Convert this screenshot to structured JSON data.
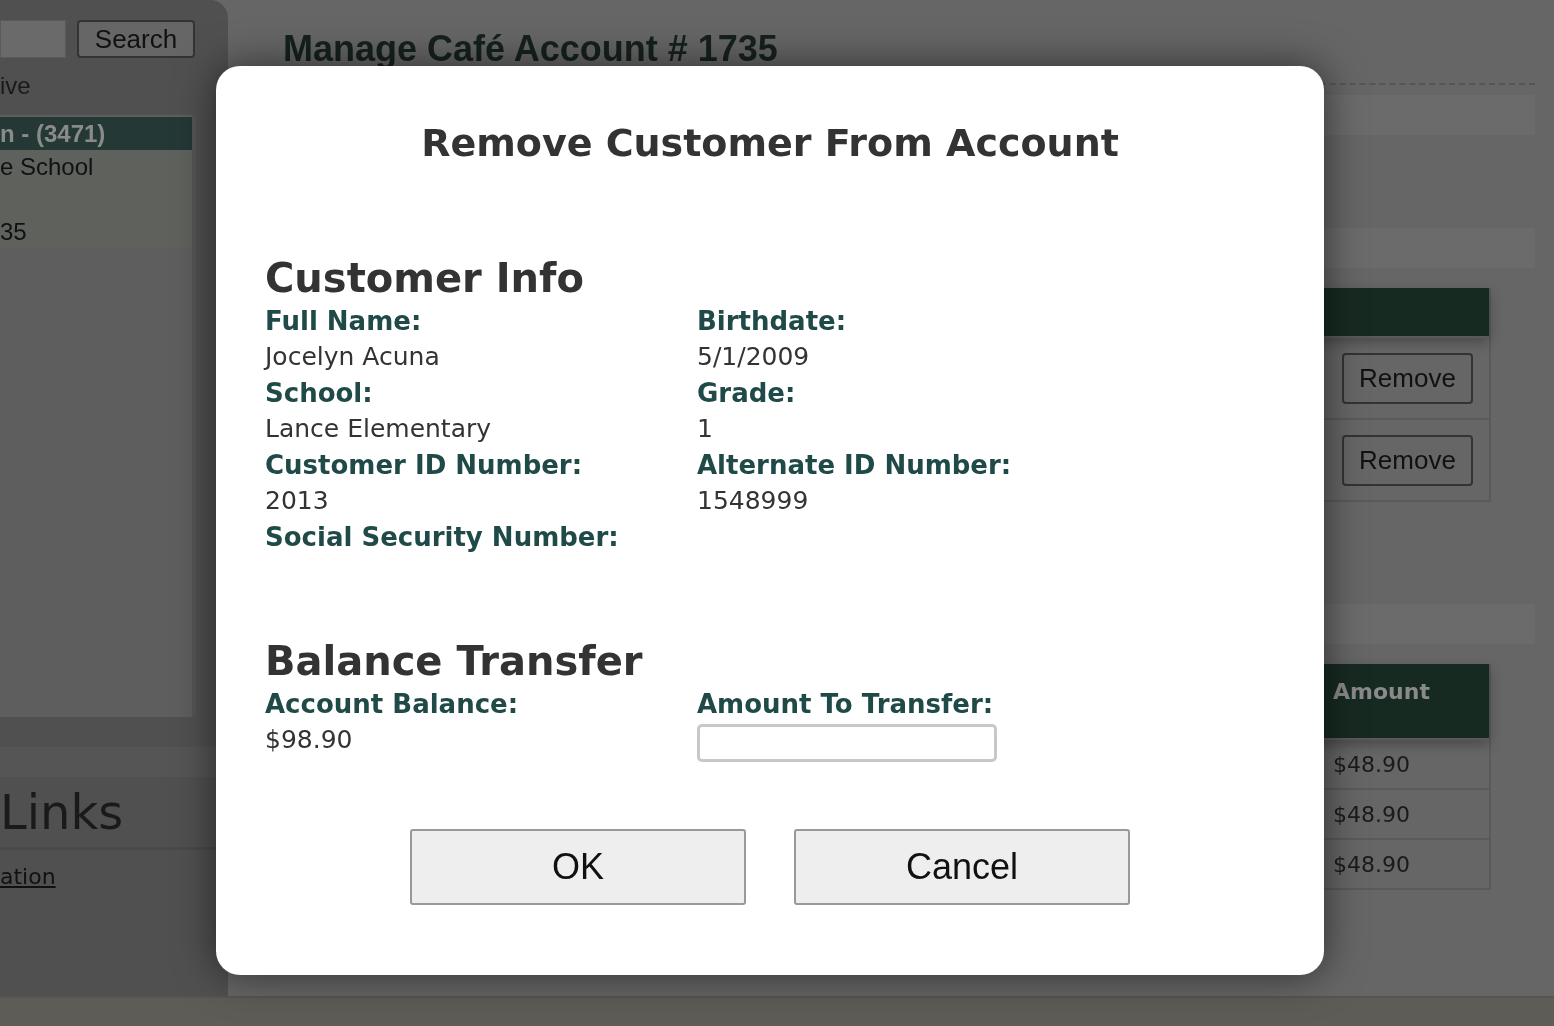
{
  "background": {
    "search_button": "Search",
    "filter_label": "ive",
    "customer_list": [
      {
        "text": "n - (3471)",
        "selected": true
      },
      {
        "text": "e School",
        "selected": false
      },
      {
        "text": "35",
        "selected": false
      }
    ],
    "links_heading": "Links",
    "link": "ation",
    "page_title": "Manage Café Account # 1735",
    "customers_table": {
      "row_buttons": [
        "Remove",
        "Remove"
      ]
    },
    "transactions_table": {
      "header": "Amount",
      "rows": [
        "$48.90",
        "$48.90",
        "$48.90"
      ]
    }
  },
  "dialog": {
    "title": "Remove Customer From Account",
    "sections": [
      {
        "heading": "Customer Info",
        "fields": [
          {
            "kind": "text",
            "label": "Full Name:",
            "value": "Jocelyn Acuna"
          },
          {
            "kind": "text",
            "label": "Birthdate:",
            "value": "5/1/2009"
          },
          {
            "kind": "text",
            "label": "School:",
            "value": "Lance Elementary"
          },
          {
            "kind": "text",
            "label": "Grade:",
            "value": "1"
          },
          {
            "kind": "text",
            "label": "Customer ID Number:",
            "value": "2013"
          },
          {
            "kind": "text",
            "label": "Alternate ID Number:",
            "value": "1548999"
          },
          {
            "kind": "text",
            "label": "Social Security Number:"
          }
        ]
      },
      {
        "heading": "Balance Transfer",
        "fields": [
          {
            "kind": "text",
            "label": "Account Balance:",
            "value": "$98.90"
          },
          {
            "kind": "input",
            "label": "Amount To Transfer:"
          }
        ]
      }
    ],
    "buttons": [
      "OK",
      "Cancel"
    ]
  }
}
